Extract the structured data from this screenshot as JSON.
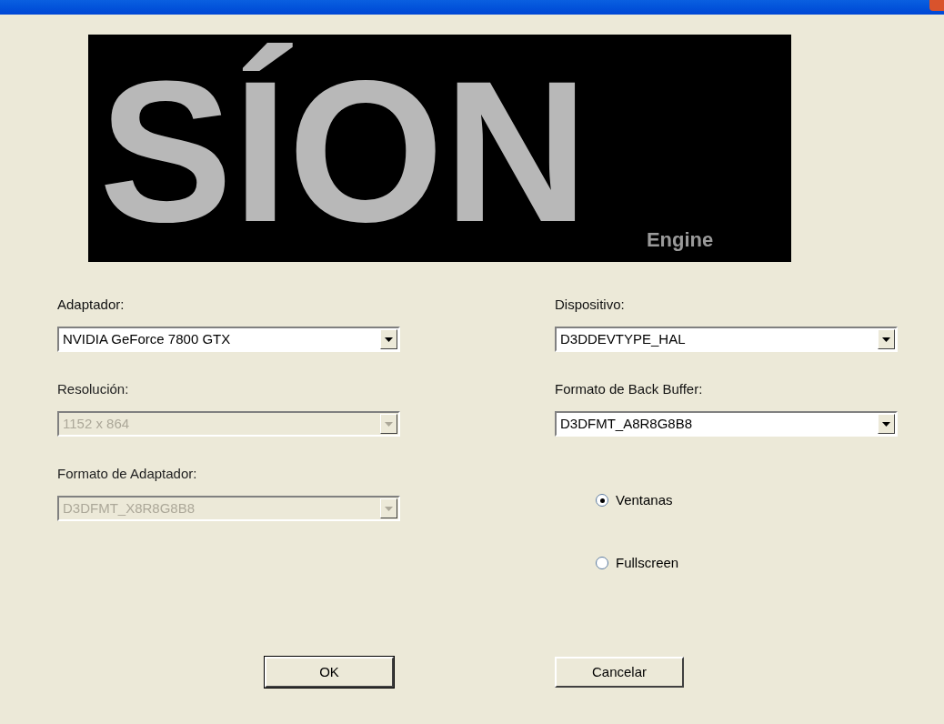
{
  "logo": {
    "title": "SÍON",
    "subtitle": "Engine"
  },
  "left_fields": [
    {
      "label": "Adaptador:",
      "value": "NVIDIA GeForce 7800 GTX",
      "disabled": false
    },
    {
      "label": "Resolución:",
      "value": "1152 x 864",
      "disabled": true
    },
    {
      "label": "Formato de Adaptador:",
      "value": "D3DFMT_X8R8G8B8",
      "disabled": true
    }
  ],
  "right_fields": [
    {
      "label": "Dispositivo:",
      "value": "D3DDEVTYPE_HAL",
      "disabled": false
    },
    {
      "label": "Formato de Back Buffer:",
      "value": "D3DFMT_A8R8G8B8",
      "disabled": false
    }
  ],
  "display_mode": [
    {
      "label": "Ventanas",
      "selected": true
    },
    {
      "label": "Fullscreen",
      "selected": false
    }
  ],
  "buttons": [
    {
      "label": "OK",
      "default": true
    },
    {
      "label": "Cancelar",
      "default": false
    }
  ]
}
